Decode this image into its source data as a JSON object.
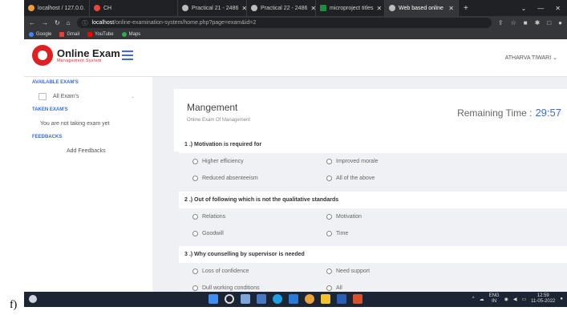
{
  "caption": "f)",
  "browser": {
    "tabs": [
      {
        "label": "localhost / 127.0.0.",
        "active": false,
        "color": "#f29c38"
      },
      {
        "label": "CH",
        "active": false,
        "color": "#e8453c"
      },
      {
        "label": "Practical 21 - 2486",
        "active": false,
        "color": "#bdbdbd"
      },
      {
        "label": "Practical 22 - 2486",
        "active": false,
        "color": "#bdbdbd"
      },
      {
        "label": "microproject titles",
        "active": false,
        "color": "#1e8e3e"
      },
      {
        "label": "Web based online",
        "active": true,
        "color": "#bdbdbd"
      }
    ],
    "new_tab": "+",
    "url_host": "localhost",
    "url_path": "/online-examination-system/home.php?page=exam&id=2",
    "bookmarks": [
      {
        "label": "Google",
        "color": "#4285f4"
      },
      {
        "label": "Gmail",
        "color": "#ea4335"
      },
      {
        "label": "YouTube",
        "color": "#ff0000"
      },
      {
        "label": "Maps",
        "color": "#34a853"
      }
    ]
  },
  "app": {
    "logo_title": "Online Exam",
    "logo_subtitle": "Management System",
    "user_name": "ATHARVA TIWARI",
    "user_caret": "⌄"
  },
  "sidebar": {
    "available_heading": "AVAILABLE EXAM'S",
    "all_exams": "All Exam's",
    "taken_heading": "TAKEN EXAM'S",
    "taken_text": "You are not taking exam yet",
    "feedback_heading": "FEEDBACKS",
    "add_feedback": "Add Feedbacks"
  },
  "exam": {
    "title": "Mangement",
    "subtitle": "Online Exam Of Management",
    "remaining_label": "Remaining Time :",
    "remaining_value": "29:57"
  },
  "questions": [
    {
      "text": "1 .) Motivation is required for",
      "options": [
        "Higher efficiency",
        "Improved morale",
        "Reduced absenteeism",
        "All of the above"
      ]
    },
    {
      "text": "2 .) Out of following which is not the qualitative standards",
      "options": [
        "Relations",
        "Motivation",
        "Goodwill",
        "Time"
      ]
    },
    {
      "text": "3 .) Why counselling by supervisor is needed",
      "options": [
        "Loss of confidence",
        "Need support",
        "Dull working conditions",
        "All"
      ]
    }
  ],
  "taskbar": {
    "lang": "ENG",
    "lang_sub": "IN",
    "time": "12:59",
    "date": "11-05-2022"
  }
}
